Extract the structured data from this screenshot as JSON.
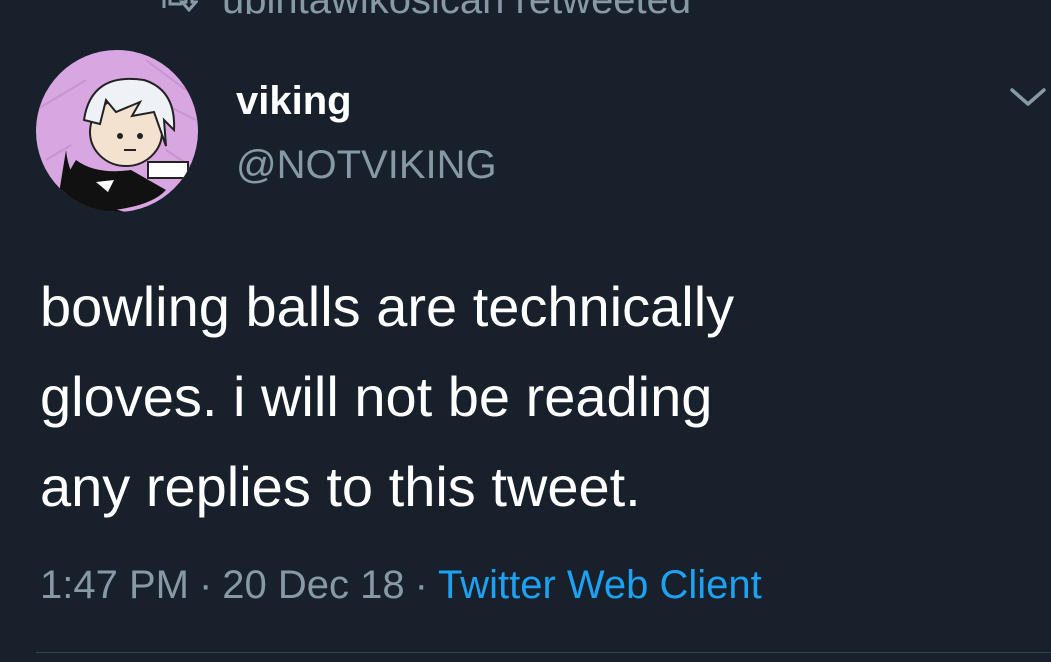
{
  "retweet_context": {
    "text": "upintawikosican retweeted"
  },
  "author": {
    "display_name": "viking",
    "handle": "@NOTVIKING"
  },
  "tweet": {
    "lines": [
      "bowling balls are technically",
      "gloves. i will not be reading",
      "any replies to this tweet."
    ]
  },
  "meta": {
    "time": "1:47 PM",
    "date": "20 Dec 18",
    "separator": "·",
    "source": "Twitter Web Client"
  },
  "icons": {
    "retweet": "retweet-icon",
    "caret": "chevron-down-icon"
  },
  "colors": {
    "background": "#18202b",
    "text_primary": "#ffffff",
    "text_secondary": "#8899a6",
    "link": "#1da1f2",
    "avatar_bg": "#d8a6e0"
  }
}
